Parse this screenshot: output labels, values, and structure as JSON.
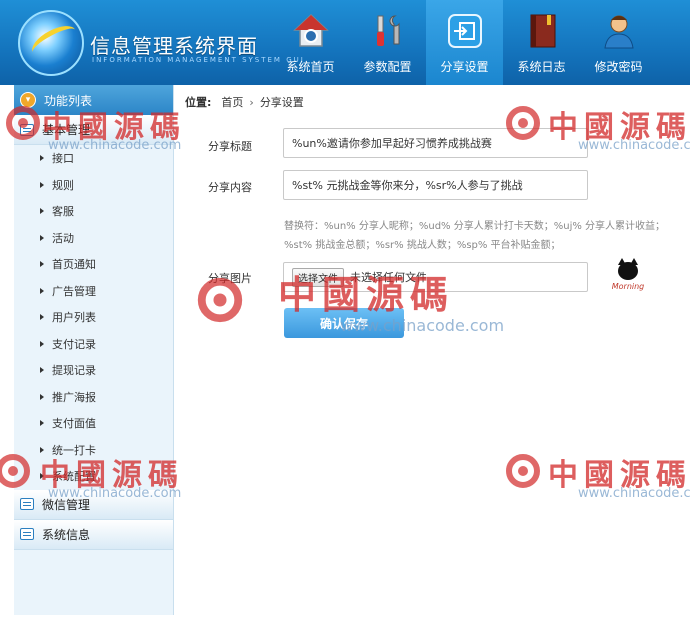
{
  "header": {
    "title": "信息管理系统界面",
    "subtitle": "INFORMATION MANAGEMENT SYSTEM GUI",
    "nav": [
      {
        "label": "系统首页",
        "icon": "home-icon"
      },
      {
        "label": "参数配置",
        "icon": "tools-icon"
      },
      {
        "label": "分享设置",
        "icon": "share-icon",
        "active": true
      },
      {
        "label": "系统日志",
        "icon": "log-book-icon"
      },
      {
        "label": "修改密码",
        "icon": "user-password-icon"
      }
    ]
  },
  "sidebar": {
    "heading": "功能列表",
    "group_basic": "基本管理",
    "items": [
      "接口",
      "规则",
      "客服",
      "活动",
      "首页通知",
      "广告管理",
      "用户列表",
      "支付记录",
      "提现记录",
      "推广海报",
      "支付面值",
      "统一打卡",
      "系统配置"
    ],
    "group_wechat": "微信管理",
    "group_system": "系统信息"
  },
  "breadcrumb": {
    "label": "位置:",
    "home": "首页",
    "separator": "›",
    "current": "分享设置"
  },
  "form": {
    "title_label": "分享标题",
    "title_value": "%un%邀请你参加早起好习惯养成挑战赛",
    "content_label": "分享内容",
    "content_value": "%st% 元挑战金等你来分，%sr%人参与了挑战",
    "hint_line1": "替换符：%un% 分享人昵称；%ud% 分享人累计打卡天数；%uj% 分享人累计收益；",
    "hint_line2": "%st% 挑战金总额；%sr% 挑战人数；%sp% 平台补贴金额；",
    "image_label": "分享图片",
    "file_button": "选择文件",
    "file_status": "未选择任何文件",
    "thumb_text": "Morning",
    "save_label": "确认保存"
  },
  "watermark": {
    "text": "中國源碼",
    "url": "www.chinacode.com"
  },
  "colors": {
    "header_blue": "#1474bd",
    "accent_button": "#3b98dd",
    "watermark_red": "#d22828"
  }
}
